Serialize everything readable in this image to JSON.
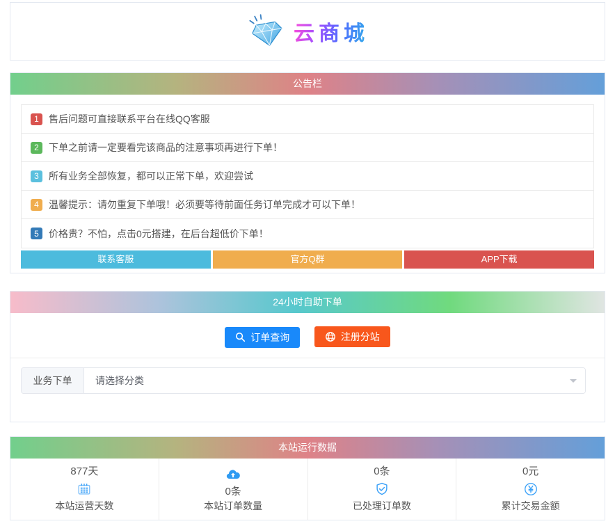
{
  "header": {
    "site_title": "云商城"
  },
  "notice": {
    "title": "公告栏",
    "items": [
      {
        "num": "1",
        "color": "#d9534f",
        "text": "售后问题可直接联系平台在线QQ客服"
      },
      {
        "num": "2",
        "color": "#5cb85c",
        "text": "下单之前请一定要看完该商品的注意事项再进行下单！"
      },
      {
        "num": "3",
        "color": "#5bc0de",
        "text": "所有业务全部恢复，都可以正常下单，欢迎尝试"
      },
      {
        "num": "4",
        "color": "#f0ad4e",
        "text": "温馨提示：请勿重复下单哦！必须要等待前面任务订单完成才可以下单！"
      },
      {
        "num": "5",
        "color": "#337ab7",
        "text": "价格贵？不怕，点击0元搭建，在后台超低价下单！"
      }
    ],
    "buttons": [
      {
        "label": "联系客服",
        "color": "#4cbbdd"
      },
      {
        "label": "官方Q群",
        "color": "#f0ad4e"
      },
      {
        "label": "APP下载",
        "color": "#d9534f"
      }
    ]
  },
  "order": {
    "title": "24小时自助下单",
    "query_button": "订单查询",
    "register_button": "注册分站",
    "form_label": "业务下单",
    "select_placeholder": "请选择分类"
  },
  "stats": {
    "title": "本站运行数据",
    "items": [
      {
        "value": "877天",
        "icon": "calendar-icon",
        "label": "本站运营天数"
      },
      {
        "value": "0条",
        "icon": "cloud-upload-icon",
        "label": "本站订单数量"
      },
      {
        "value": "0条",
        "icon": "shield-check-icon",
        "label": "已处理订单数"
      },
      {
        "value": "0元",
        "icon": "yen-circle-icon",
        "label": "累计交易金额"
      }
    ]
  },
  "colors": {
    "primary_blue": "#1989fa",
    "accent_orange": "#f8571c",
    "icon_blue": "#3da2f8"
  }
}
